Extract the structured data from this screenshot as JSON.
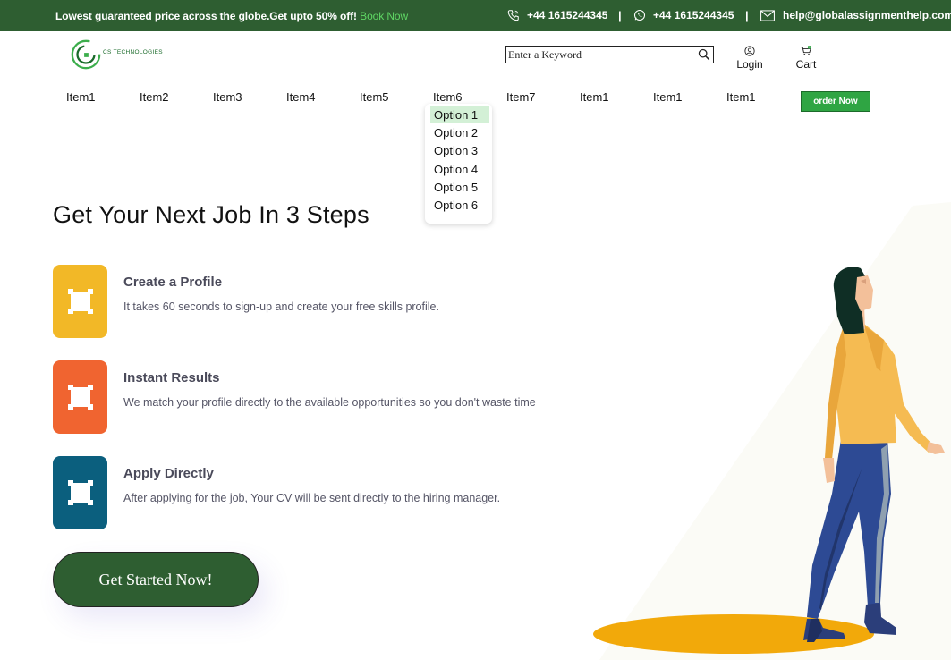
{
  "topbar": {
    "promo_text": "Lowest guaranteed price across the globe.Get upto 50% off! ",
    "promo_link": "Book Now",
    "phone1": "+44 1615244345",
    "separator1": "|",
    "phone2": "+44 1615244345",
    "separator2": "|",
    "email": "help@globalassignmenthelp.com"
  },
  "header": {
    "logo_text": "CS TECHNOLOGIES",
    "search_placeholder": "Enter a Keyword",
    "login_label": "Login",
    "cart_label": "Cart",
    "cart_count": "0"
  },
  "nav": {
    "items": [
      "Item1",
      "Item2",
      "Item3",
      "Item4",
      "Item5",
      "Item6",
      "Item7",
      "Item1",
      "Item1",
      "Item1"
    ],
    "order_button": "order Now"
  },
  "dropdown": {
    "options": [
      "Option 1",
      "Option 2",
      "Option 3",
      "Option 4",
      "Option 5",
      "Option 6"
    ],
    "selected": "Option 1"
  },
  "main": {
    "heading": "Get Your Next Job In 3 Steps",
    "steps": [
      {
        "title": "Create a Profile",
        "desc": "It takes 60 seconds to sign-up and create your free skills profile.",
        "color": "#f2b827"
      },
      {
        "title": "Instant Results",
        "desc": "We match your profile directly to the available opportunities so you don't waste time",
        "color": "#f06430"
      },
      {
        "title": "Apply Directly",
        "desc": "After applying for the job, Your CV will be sent directly to the hiring manager.",
        "color": "#0b5f7e"
      }
    ],
    "cta_label": "Get Started Now!"
  },
  "colors": {
    "brand_green": "#2e5e31",
    "accent_green": "#2fa543",
    "link_green": "#5fd764"
  }
}
